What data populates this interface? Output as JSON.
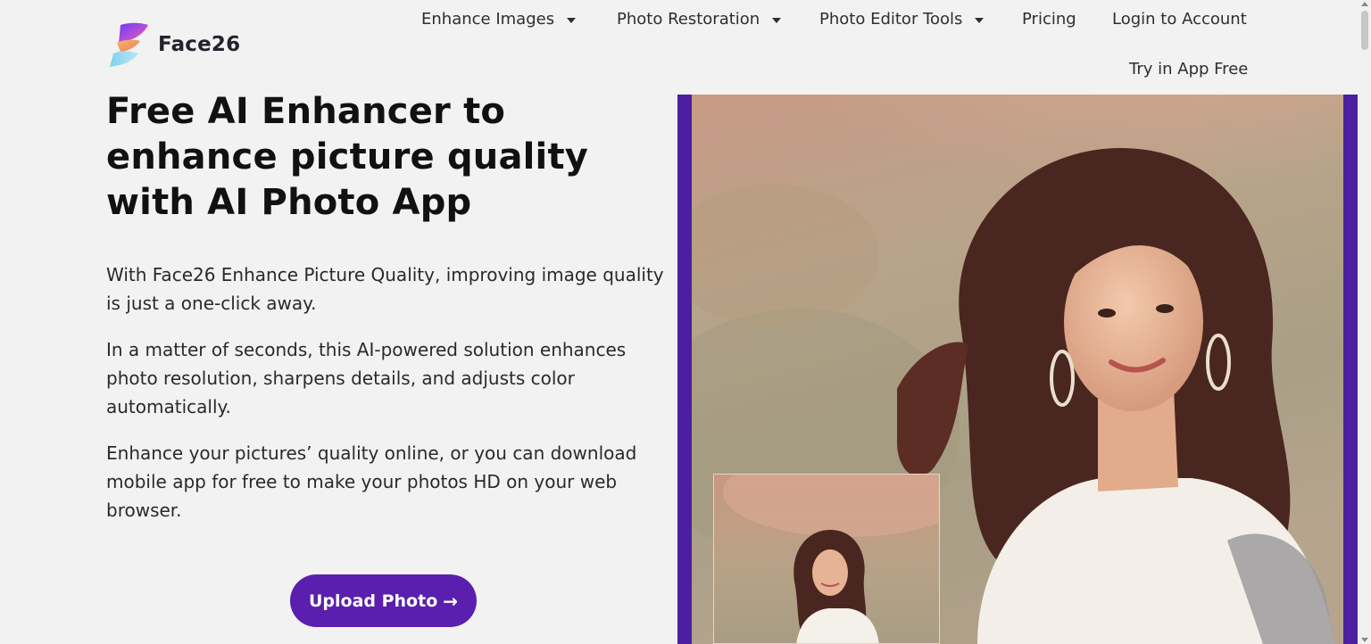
{
  "brand": {
    "name": "Face26",
    "logo_icon": "face26-logo-icon",
    "accent_color": "#5a1fae"
  },
  "nav": {
    "items": [
      {
        "label": "Enhance Images",
        "has_dropdown": true
      },
      {
        "label": "Photo Restoration",
        "has_dropdown": true
      },
      {
        "label": "Photo Editor Tools",
        "has_dropdown": true
      },
      {
        "label": "Pricing",
        "has_dropdown": false
      },
      {
        "label": "Login to Account",
        "has_dropdown": false
      }
    ],
    "try_app": "Try in App Free"
  },
  "hero": {
    "title": "Free AI Enhancer to enhance picture quality with AI Photo App",
    "paragraphs": [
      "With Face26 Enhance Picture Quality, improving image quality is just a one-click away.",
      "In a matter of seconds, this AI-powered solution enhances photo resolution, sharpens details, and adjusts color automatically.",
      "Enhance your pictures’ quality online, or you can download mobile app for free to make your photos HD on your web browser."
    ],
    "upload_button": "Upload Photo",
    "upload_icon": "arrow-right-icon",
    "frame_color": "#4c1fa0"
  }
}
